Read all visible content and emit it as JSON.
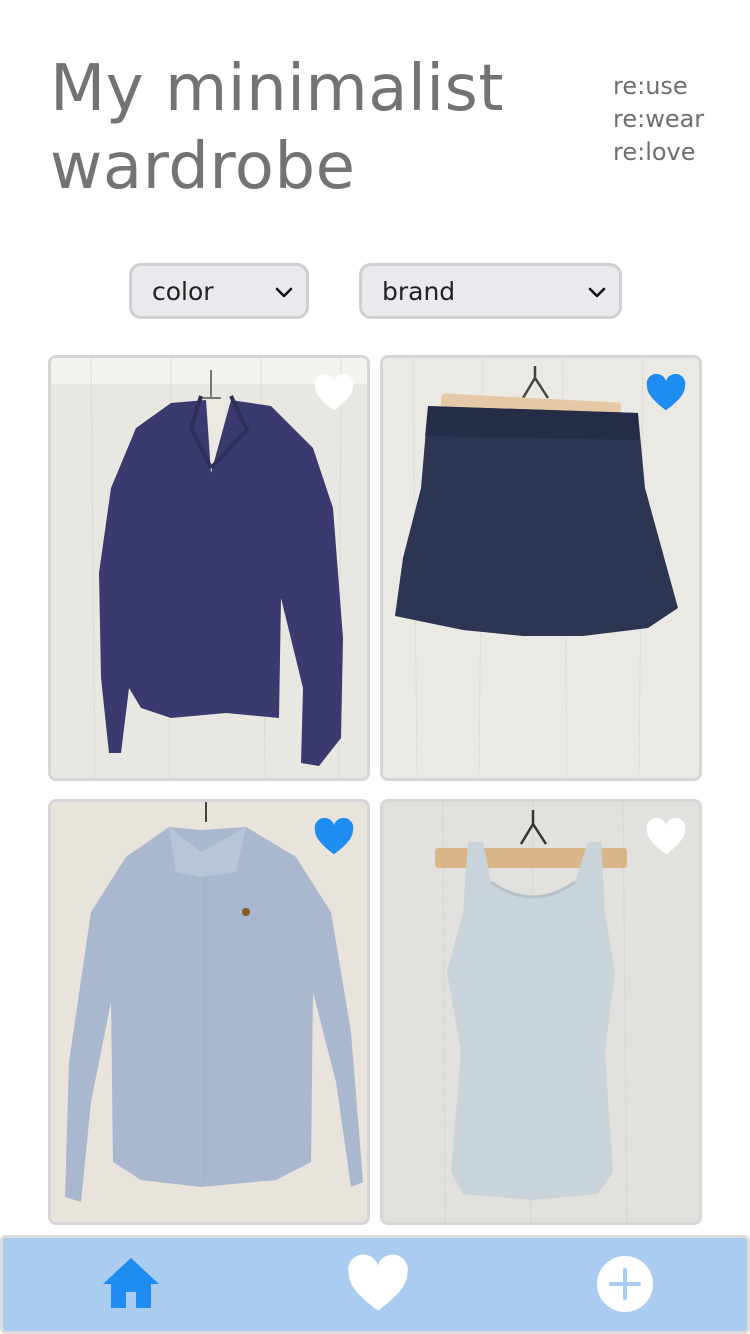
{
  "header": {
    "title": "My minimalist wardrobe",
    "tagline": [
      "re:use",
      "re:wear",
      "re:love"
    ]
  },
  "filters": {
    "color": {
      "selected": "color"
    },
    "brand": {
      "selected": "brand"
    }
  },
  "items": [
    {
      "kind": "knit sweater",
      "color": "#3a3a6e",
      "favorite": false
    },
    {
      "kind": "eyelet skirt",
      "color": "#2c3552",
      "favorite": true
    },
    {
      "kind": "striped shirt",
      "color": "#a9b8cf",
      "favorite": true
    },
    {
      "kind": "tank top",
      "color": "#c9d4da",
      "favorite": false
    }
  ],
  "nav": {
    "home_icon": "home-icon",
    "favorites_icon": "heart-icon",
    "add_icon": "plus-icon",
    "active": "home"
  },
  "colors": {
    "accent": "#1e8cf0",
    "nav_bg": "#a9ccf0",
    "heart_inactive": "#ffffff"
  }
}
